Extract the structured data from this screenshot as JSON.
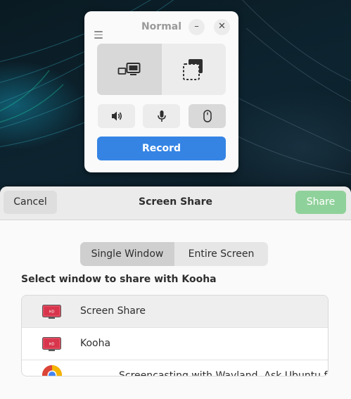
{
  "kooha": {
    "title": "Normal",
    "menu_icon": "hamburger-icon",
    "minimize_glyph": "–",
    "close_glyph": "✕",
    "record_label": "Record",
    "modes": [
      {
        "name": "monitor-window-icon",
        "active": true
      },
      {
        "name": "selection-icon",
        "active": false
      }
    ],
    "features": [
      {
        "name": "speaker-icon",
        "on": false
      },
      {
        "name": "microphone-icon",
        "on": false
      },
      {
        "name": "mouse-icon",
        "on": true
      }
    ],
    "colors": {
      "accent": "#3584e4"
    }
  },
  "portal": {
    "title": "Screen Share",
    "cancel_label": "Cancel",
    "share_label": "Share",
    "source_options": [
      "Single Window",
      "Entire Screen"
    ],
    "selected_option": "Single Window",
    "prompt": "Select window to share with Kooha",
    "windows": [
      {
        "label": "Screen Share",
        "icon": "kooha-app-icon",
        "selected": true
      },
      {
        "label": "Kooha",
        "icon": "kooha-app-icon",
        "selected": false
      },
      {
        "label": "Screencasting with Wayland, Ask Ubuntu for",
        "icon": "chrome-icon",
        "selected": false
      }
    ],
    "colors": {
      "share_button": "#8fd19a"
    }
  }
}
